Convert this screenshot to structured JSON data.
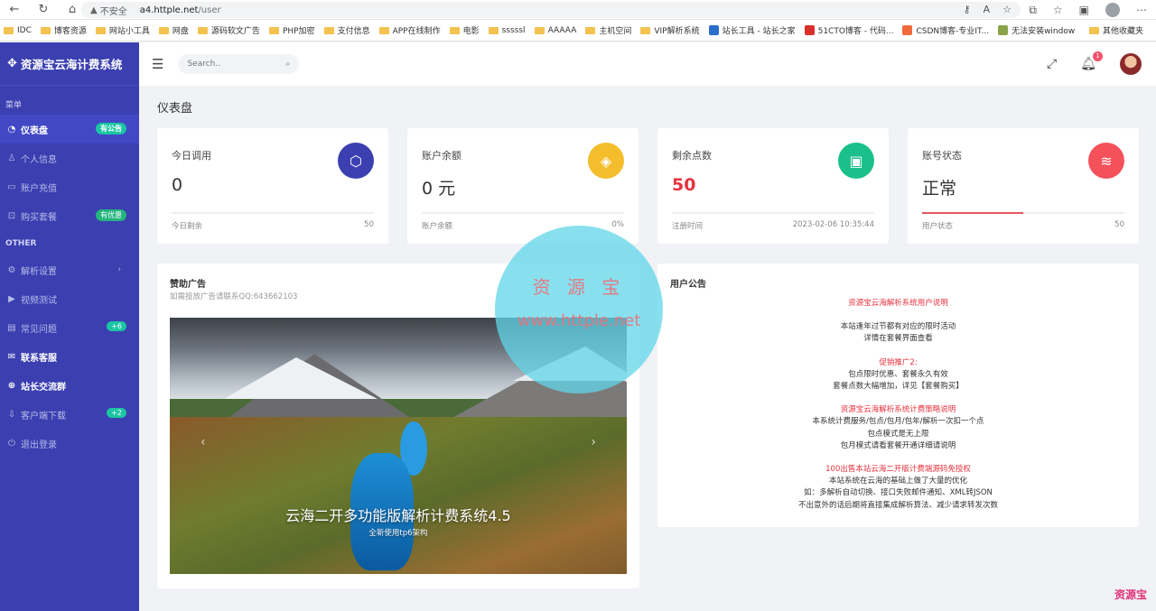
{
  "browser": {
    "security_label": "不安全",
    "url_host": "a4.httple.net",
    "url_path": "/user",
    "bookmarks": [
      "IDC",
      "博客资源",
      "网站小工具",
      "网盘",
      "源码软文广告",
      "PHP加密",
      "支付信息",
      "APP在线制作",
      "电影",
      "sssssl",
      "AAAAA",
      "主机空间",
      "VIP解析系统",
      "站长工具 - 站长之家",
      "51CTO博客 - 代码...",
      "CSDN博客-专业IT...",
      "无法安装windows..."
    ],
    "other_bookmarks": "其他收藏夹"
  },
  "sidebar": {
    "brand": "资源宝云海计费系统",
    "caption_menu": "菜单",
    "caption_other": "OTHER",
    "items": [
      {
        "label": "仪表盘",
        "icon": "dashboard-icon",
        "badge": "有公告"
      },
      {
        "label": "个人信息",
        "icon": "user-icon"
      },
      {
        "label": "账户充值",
        "icon": "wallet-icon"
      },
      {
        "label": "购买套餐",
        "icon": "cart-icon",
        "badge": "有优惠"
      },
      {
        "label": "解析设置",
        "icon": "settings-icon"
      },
      {
        "label": "视频测试",
        "icon": "video-icon"
      },
      {
        "label": "常见问题",
        "icon": "doc-icon",
        "badge": "+6"
      },
      {
        "label": "联系客服",
        "icon": "chat-icon"
      },
      {
        "label": "站长交流群",
        "icon": "plus-circle-icon"
      },
      {
        "label": "客户端下载",
        "icon": "download-icon",
        "badge": "+2"
      },
      {
        "label": "退出登录",
        "icon": "power-icon"
      }
    ]
  },
  "topbar": {
    "search_placeholder": "Search..",
    "notification_count": "1"
  },
  "page": {
    "title": "仪表盘"
  },
  "stats": [
    {
      "label": "今日调用",
      "value": "0",
      "foot_left": "今日剩余",
      "foot_right": "50",
      "color": "#3b3fb0",
      "icon": "cube-icon",
      "progress": 0
    },
    {
      "label": "账户余额",
      "value": "0 元",
      "foot_left": "账户余额",
      "foot_right": "0%",
      "color": "#f4bd2c",
      "icon": "tag-icon",
      "progress": 0
    },
    {
      "label": "剩余点数",
      "value": "50",
      "foot_left": "注册时间",
      "foot_right": "2023-02-06 10:35:44",
      "color": "#1bbf8a",
      "icon": "briefcase-icon",
      "progress": 0
    },
    {
      "label": "账号状态",
      "value": "正常",
      "foot_left": "用户状态",
      "foot_right": "50",
      "color": "#f4515a",
      "icon": "layers-icon",
      "progress": 0.5
    }
  ],
  "ad": {
    "title": "赞助广告",
    "subtitle": "如需投放广告请联系QQ:643662103",
    "caption": "云海二开多功能版解析计费系统4.5",
    "subcaption": "全新使用tp6架构"
  },
  "notice": {
    "title": "用户公告",
    "lines": [
      {
        "text": "资源宝云海解析系统用户说明",
        "red": true
      },
      {
        "text": "",
        "gap": true
      },
      {
        "text": "本站逢年过节都有对应的限时活动"
      },
      {
        "text": "详情在套餐界面查看"
      },
      {
        "text": "",
        "gap": true
      },
      {
        "text": "促销推广2:",
        "red": true
      },
      {
        "text": "包点限时优惠、套餐永久有效"
      },
      {
        "text": "套餐点数大幅增加，详见【套餐购买】"
      },
      {
        "text": "",
        "gap": true
      },
      {
        "text": "资源宝云海解析系统计费策略说明",
        "red": true
      },
      {
        "text": "本系统计费服务/包点/包月/包年/解析一次扣一个点"
      },
      {
        "text": "包点模式是无上限"
      },
      {
        "text": "包月模式请看套餐开通详细请说明"
      },
      {
        "text": "",
        "gap": true
      },
      {
        "text": "100出售本站云海二开版计费端源码免授权",
        "red": true
      },
      {
        "text": "本站系统在云海的基础上做了大量的优化"
      },
      {
        "text": "如：多解析自动切换、接口失败邮件通知、XML转JSON"
      },
      {
        "text": "不出意外的话后期将直接集成解析算法、减少请求转发次数"
      }
    ]
  },
  "watermark": {
    "name": "资 源 宝",
    "site": "www.httple.net",
    "corner": "资源宝"
  }
}
